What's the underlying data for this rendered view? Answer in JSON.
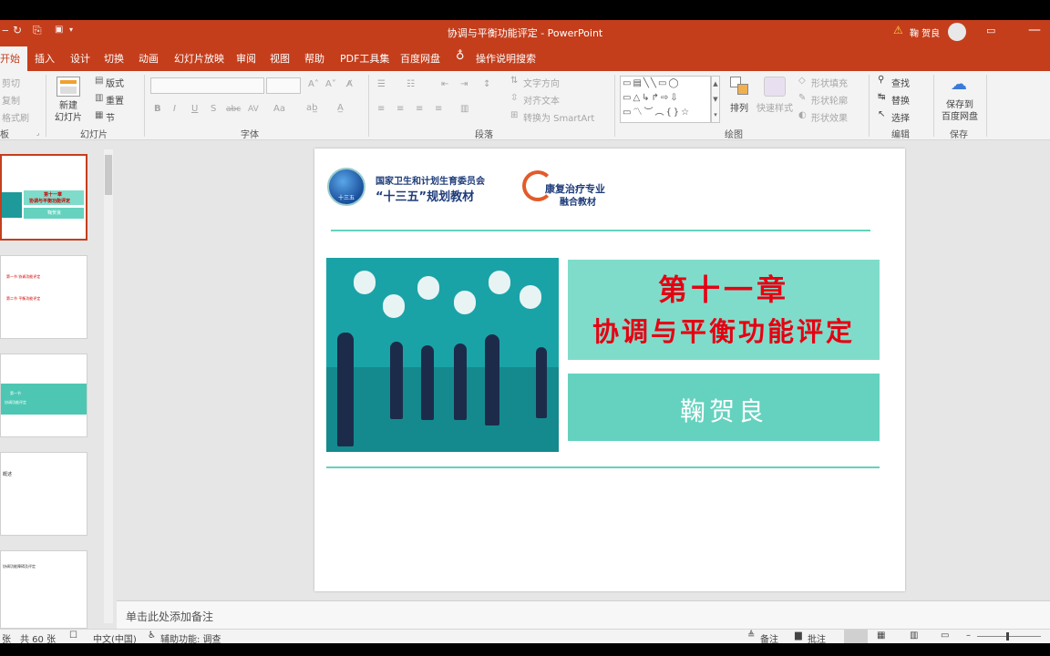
{
  "window": {
    "title": "协调与平衡功能评定 - PowerPoint",
    "user": "鞠 贺良"
  },
  "tabs": [
    "开始",
    "插入",
    "设计",
    "切换",
    "动画",
    "幻灯片放映",
    "审阅",
    "视图",
    "帮助",
    "PDF工具集",
    "百度网盘",
    "操作说明搜索"
  ],
  "ribbon": {
    "clipboard": {
      "cut": "剪切",
      "copy": "复制",
      "format_painter": "格式刷",
      "group": "板"
    },
    "slides": {
      "new_slide": "新建\n幻灯片",
      "layout": "版式",
      "reset": "重置",
      "section": "节",
      "group": "幻灯片"
    },
    "font": {
      "group": "字体",
      "bold": "B",
      "italic": "I",
      "underline": "U",
      "shadow": "S",
      "strike": "abc",
      "spacing": "AV",
      "case": "Aa"
    },
    "paragraph": {
      "group": "段落",
      "text_direction": "文字方向",
      "align_text": "对齐文本",
      "convert_smartart": "转换为 SmartArt"
    },
    "drawing": {
      "group": "绘图",
      "arrange": "排列",
      "quick_styles": "快速样式",
      "shape_fill": "形状填充",
      "shape_outline": "形状轮廓",
      "shape_effects": "形状效果"
    },
    "editing": {
      "group": "编辑",
      "find": "查找",
      "replace": "替换",
      "select": "选择"
    },
    "save": {
      "group": "保存",
      "label": "保存到\n百度网盘"
    }
  },
  "slide": {
    "org_line1": "国家卫生和计划生育委员会",
    "org_line2": "“十三五”规划教材",
    "logo_badge": "十三五",
    "brand_line1": "康复治疗专业",
    "brand_line2": "融合教材",
    "chapter": "第十一章",
    "title": "协调与平衡功能评定",
    "author": "鞠贺良"
  },
  "notes_placeholder": "单击此处添加备注",
  "status": {
    "slide_prefix": "张",
    "slide_count": "共 60 张",
    "language": "中文(中国)",
    "accessibility": "辅助功能: 调查",
    "notes": "备注",
    "comments": "批注"
  },
  "thumbnails": {
    "t1_title1": "第十一章",
    "t1_title2": "协调与平衡功能评定",
    "t1_author": "鞠贺良",
    "t2_a": "第一节  协调功能评定",
    "t2_b": "第二节  平衡功能评定",
    "t3_a": "第一节",
    "t3_b": "协调功能评定",
    "t4_a": "概述",
    "t5_a": "协调功能障碍及评定"
  },
  "colors": {
    "accent": "#c43e1c",
    "teal": "#64d2be",
    "teal_light": "#7fdcca",
    "title_red": "#e60012"
  }
}
